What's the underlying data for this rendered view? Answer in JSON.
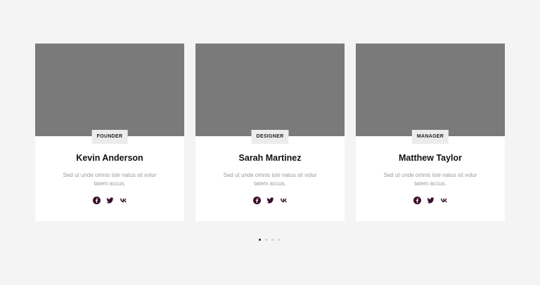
{
  "team": {
    "members": [
      {
        "role": "FOUNDER",
        "name": "Kevin Anderson",
        "bio": "Sed ut unde omnis iste natus sit volur tatem accus."
      },
      {
        "role": "DESIGNER",
        "name": "Sarah Martinez",
        "bio": "Sed ut unde omnis iste natus sit volur tatem accus."
      },
      {
        "role": "MANAGER",
        "name": "Matthew Taylor",
        "bio": "Sed ut unde omnis iste natus sit volur tatem accus."
      }
    ],
    "social_icons": [
      "facebook-icon",
      "twitter-icon",
      "vk-icon"
    ],
    "icon_color": "#3b1030"
  },
  "pagination": {
    "count": 4,
    "active": 1
  }
}
